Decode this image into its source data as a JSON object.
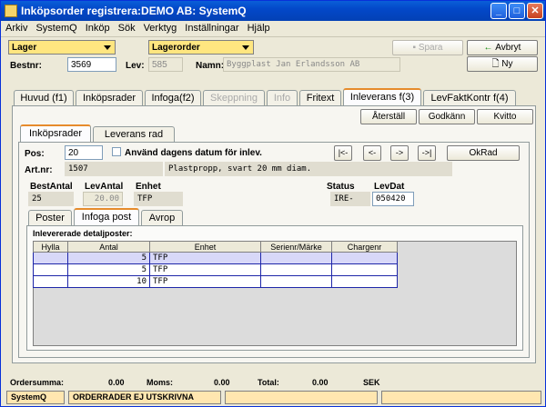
{
  "window": {
    "title": "Inköpsorder registrera:DEMO AB: SystemQ"
  },
  "menu": [
    "Arkiv",
    "SystemQ",
    "Inköp",
    "Sök",
    "Verktyg",
    "Inställningar",
    "Hjälp"
  ],
  "header": {
    "lager": "Lager",
    "lagerorder": "Lagerorder",
    "spara": "Spara",
    "avbryt": "Avbryt",
    "ny": "Ny",
    "bestnr_label": "Bestnr:",
    "bestnr": "3569",
    "lev_label": "Lev:",
    "lev": "585",
    "namn_label": "Namn:",
    "namn": "Byggplast Jan Erlandsson AB"
  },
  "tabs": [
    "Huvud (f1)",
    "Inköpsrader",
    "Infoga(f2)",
    "Skeppning",
    "Info",
    "Fritext",
    "Inleverans f(3)",
    "LevFaktKontr f(4)"
  ],
  "actions": {
    "aterstall": "Återställ",
    "godkann": "Godkänn",
    "kvitto": "Kvitto"
  },
  "subtabs": [
    "Inköpsrader",
    "Leverans rad"
  ],
  "row": {
    "pos_label": "Pos:",
    "pos": "20",
    "dagens": "Använd dagens datum för inlev.",
    "nav": [
      "|<-",
      "<-",
      "->",
      "->|"
    ],
    "okrad": "OkRad",
    "artnr_label": "Art.nr:",
    "artnr": "1507",
    "benamning": "Plastpropp, svart 20 mm diam.",
    "bestantal_label": "BestAntal",
    "levantal_label": "LevAntal",
    "enhet_label": "Enhet",
    "status_label": "Status",
    "levdat_label": "LevDat",
    "bestantal": "25",
    "levantal": "20.00",
    "enhet": "TFP",
    "status": "IRE-",
    "levdat": "050420"
  },
  "innertabs": [
    "Poster",
    "Infoga post",
    "Avrop"
  ],
  "detail": {
    "title": "Inlevererade detaljposter:",
    "columns": [
      "Hylla",
      "Antal",
      "Enhet",
      "Serienr/Märke",
      "Chargenr"
    ],
    "rows": [
      [
        "",
        "5",
        "TFP",
        "",
        ""
      ],
      [
        "",
        "5",
        "TFP",
        "",
        ""
      ],
      [
        "",
        "10",
        "TFP",
        "",
        ""
      ]
    ]
  },
  "totals": {
    "ordersumma_label": "Ordersumma:",
    "ordersumma": "0.00",
    "moms_label": "Moms:",
    "moms": "0.00",
    "total_label": "Total:",
    "total": "0.00",
    "currency": "SEK"
  },
  "statusbar": {
    "app": "SystemQ",
    "message": "ORDERRADER EJ UTSKRIVNA"
  }
}
